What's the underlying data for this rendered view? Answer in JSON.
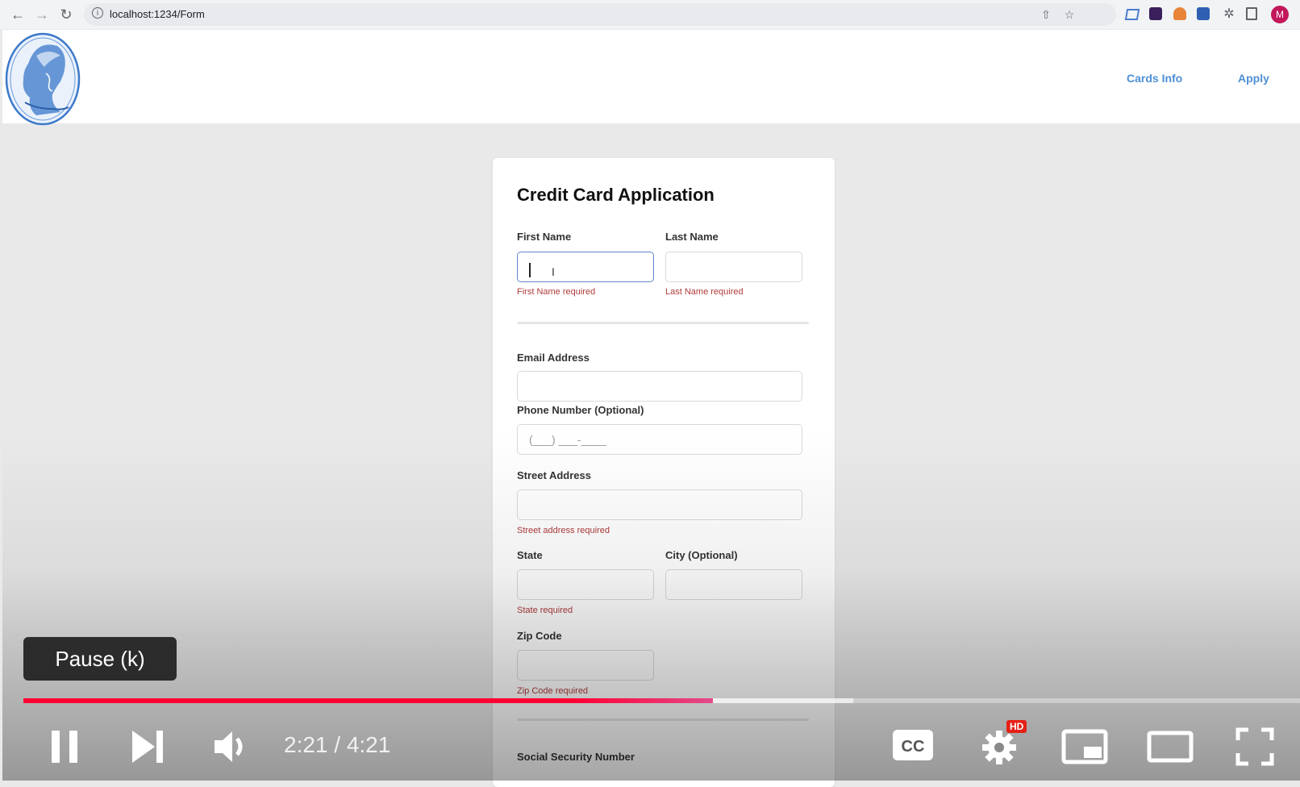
{
  "browser": {
    "url": "localhost:1234/Form",
    "avatar_letter": "M"
  },
  "site": {
    "nav": {
      "cards_info": "Cards Info",
      "apply": "Apply"
    }
  },
  "form": {
    "title": "Credit Card Application",
    "first_name": {
      "label": "First Name",
      "value": "",
      "error": "First Name required"
    },
    "last_name": {
      "label": "Last Name",
      "value": "",
      "error": "Last Name required"
    },
    "email": {
      "label": "Email Address",
      "value": ""
    },
    "phone": {
      "label": "Phone Number (Optional)",
      "placeholder": "(___) ___-____"
    },
    "street": {
      "label": "Street Address",
      "value": "",
      "error": "Street address required"
    },
    "state": {
      "label": "State",
      "value": "",
      "error": "State required"
    },
    "city": {
      "label": "City (Optional)",
      "value": ""
    },
    "zip": {
      "label": "Zip Code",
      "value": "",
      "error": "Zip Code required"
    },
    "ssn": {
      "label": "Social Security Number"
    }
  },
  "video": {
    "tooltip": "Pause (k)",
    "time": "2:21 / 4:21",
    "hd_badge": "HD",
    "progress_fraction": 0.54,
    "buffered_fraction": 0.65,
    "colors": {
      "played": "#ff0033",
      "played_end": "#e24a8a",
      "badge": "#e62117"
    }
  },
  "colors": {
    "nav_link": "#4e8fd6",
    "error": "#b03a3a",
    "focus_border": "#5f87c9"
  }
}
